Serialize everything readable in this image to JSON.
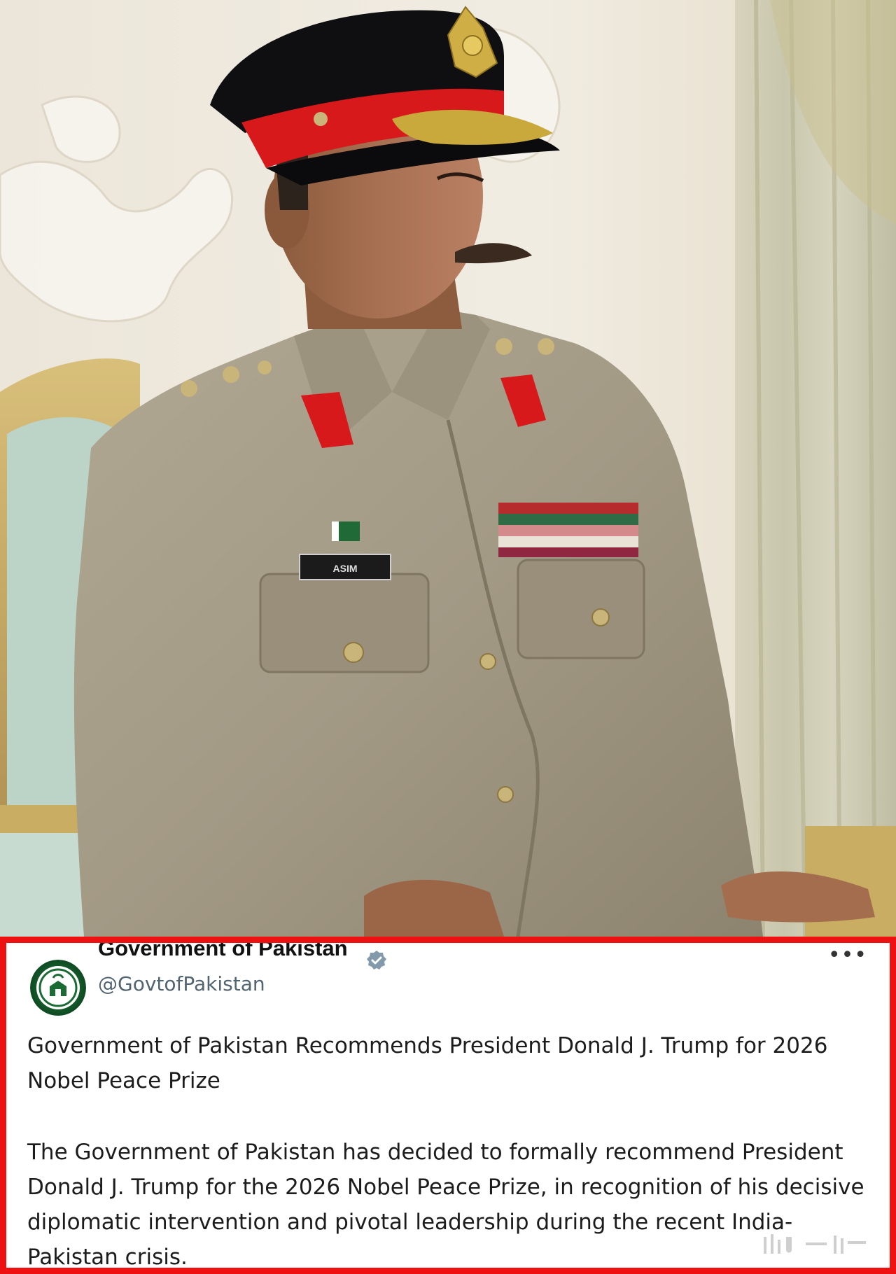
{
  "photo": {
    "nameplate": "ASIM"
  },
  "tweet": {
    "display_name": "Government of Pakistan",
    "handle": "@GovtofPakistan",
    "more_icon": "more-options-icon",
    "verified_icon": "verified-badge-icon",
    "headline": "Government of Pakistan Recommends President Donald J. Trump for 2026 Nobel Peace Prize",
    "body": "The Government of Pakistan has decided to formally recommend President Donald J. Trump for the 2026 Nobel Peace Prize, in recognition of his decisive diplomatic intervention and pivotal leadership during the recent India-Pakistan crisis."
  },
  "colors": {
    "highlight_border": "#ee1111",
    "uniform": "#a39a86",
    "cap_band": "#d7191c",
    "handle_gray": "#536471"
  }
}
